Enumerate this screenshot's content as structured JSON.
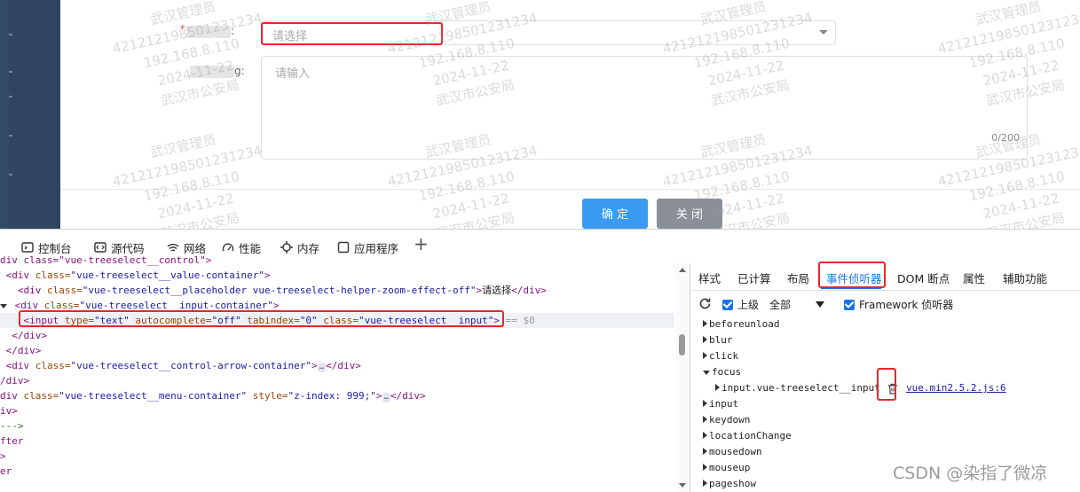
{
  "form": {
    "field1_label_suffix": ":",
    "field2_label_suffix": "g:",
    "select_placeholder": "请选择",
    "textarea_placeholder": "请输入",
    "char_count": "0/200",
    "ok_label": "确 定",
    "close_label": "关 闭"
  },
  "watermark": {
    "line1": "武汉管理员",
    "line2": "421212198501231234",
    "line3": "192.168.8.110",
    "line4": "2024-11-22",
    "line5": "武汉市公安局"
  },
  "devtools": {
    "tabs": [
      "控制台",
      "源代码",
      "网络",
      "性能",
      "内存",
      "应用程序"
    ],
    "add_tab": "+",
    "side_tabs": [
      "样式",
      "已计算",
      "布局",
      "事件侦听器",
      "DOM 断点",
      "属性",
      "辅助功能"
    ],
    "toolbar": {
      "ancestors_label": "上级",
      "filter_value": "全部",
      "framework_label": "Framework 侦听器"
    },
    "code": {
      "l0": "div class=\"vue-treeselect__control\">",
      "l1_tag": "<div ",
      "l1_attr": "class=",
      "l1_val": "\"vue-treeselect__value-container\"",
      "l1_end": ">",
      "l2_tag": "<div ",
      "l2_attr": "class=",
      "l2_val": "\"vue-treeselect__placeholder vue-treeselect-helper-zoom-effect-off\"",
      "l2_text": "请选择",
      "l2_close": "</div>",
      "l3_tag": "<div ",
      "l3_attr": "class=",
      "l3_val": "\"vue-treeselect__input-container\"",
      "l3_end": ">",
      "l4_tag": "<input ",
      "l4_a1": "type=",
      "l4_v1": "\"text\"",
      "l4_a2": " autocomplete=",
      "l4_v2": "\"off\"",
      "l4_a3": " tabindex=",
      "l4_v3": "\"0\"",
      "l4_a4": " class=",
      "l4_v4": "\"vue-treeselect__input\"",
      "l4_end": ">",
      "l4_ref": " == $0",
      "l5": "</div>",
      "l6": "</div>",
      "l7_tag": "<div ",
      "l7_attr": "class=",
      "l7_val": "\"vue-treeselect__control-arrow-container\"",
      "l7_close": "</div>",
      "l8": "/div>",
      "l9_tag": "div ",
      "l9_a1": "class=",
      "l9_v1": "\"vue-treeselect__menu-container\"",
      "l9_a2": " style=",
      "l9_v2": "\"z-index: 999;\"",
      "l9_close": "</div>",
      "l10": "iv>",
      "l11": "--->",
      "l12": "fter",
      "l13": ">",
      "l14": "er",
      "dots": "…"
    },
    "events": [
      "beforeunload",
      "blur",
      "click",
      "focus",
      "input",
      "keydown",
      "locationChange",
      "mousedown",
      "mouseup",
      "pageshow"
    ],
    "focus_child": "input.vue-treeselect__input",
    "focus_link": "vue.min2.5.2.js:6"
  },
  "csdn_watermark": "CSDN @染指了微凉"
}
